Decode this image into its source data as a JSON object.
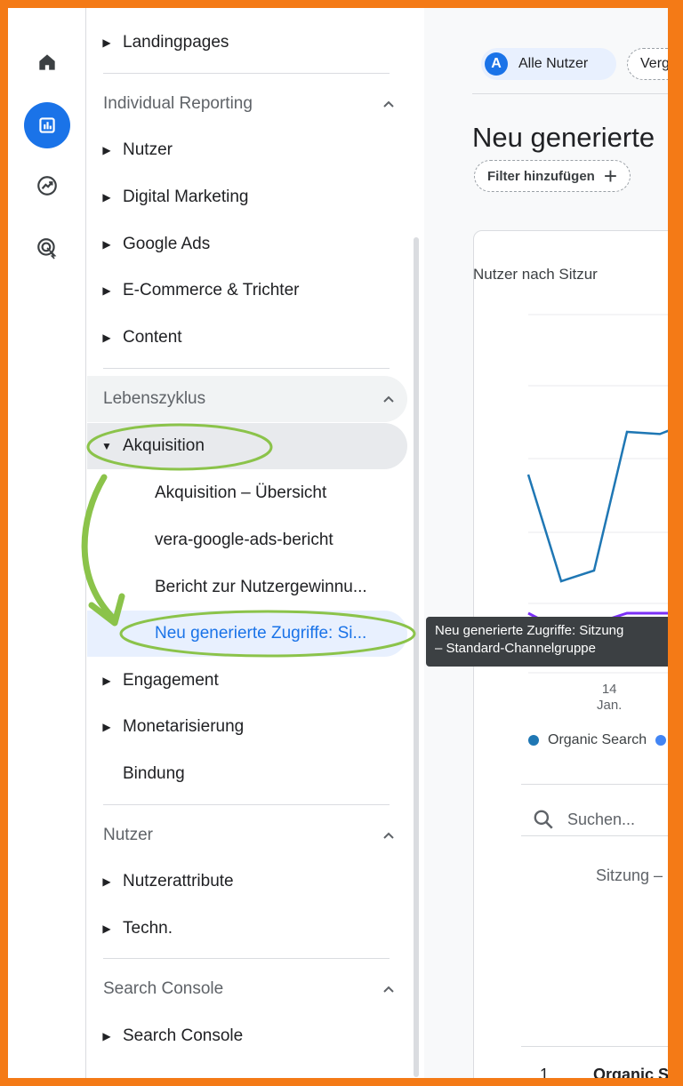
{
  "rail": {
    "icons": [
      "home-icon",
      "reports-icon",
      "explore-icon",
      "advertising-icon"
    ]
  },
  "nav": {
    "landingpages": "Landingpages",
    "individual_reporting": {
      "title": "Individual Reporting",
      "items": [
        "Nutzer",
        "Digital Marketing",
        "Google Ads",
        "E-Commerce & Trichter",
        "Content"
      ]
    },
    "lebenszyklus": {
      "title": "Lebenszyklus",
      "akquisition": "Akquisition",
      "akquisition_children": [
        "Akquisition – Übersicht",
        "vera-google-ads-bericht",
        "Bericht zur Nutzergewinnu...",
        "Neu generierte Zugriffe: Si..."
      ],
      "engagement": "Engagement",
      "monetarisierung": "Monetarisierung",
      "bindung": "Bindung"
    },
    "nutzer": {
      "title": "Nutzer",
      "items": [
        "Nutzerattribute",
        "Techn."
      ]
    },
    "search_console": {
      "title": "Search Console",
      "items": [
        "Search Console"
      ]
    }
  },
  "main": {
    "segment_avatar": "A",
    "segment_label": "Alle Nutzer",
    "compare_label": "Verg",
    "title": "Neu generierte",
    "filter_label": "Filter hinzufügen",
    "card_title": "Nutzer nach Sitzur",
    "x_tick_day": "14",
    "x_tick_month": "Jan.",
    "legend_label": "Organic Search",
    "search_placeholder": "Suchen...",
    "column_header": "Sitzung –",
    "row1_index": "1",
    "row1_label": "Organic S"
  },
  "tooltip": {
    "line1": "Neu generierte Zugriffe: Sitzung",
    "line2": "– Standard-Channelgruppe"
  },
  "colors": {
    "accent": "#1a73e8",
    "annotation": "#8bc34a",
    "border": "#f47a16",
    "series_organic": "#1f77b4",
    "series_purple": "#7b2ff7"
  },
  "chart_data": {
    "type": "line",
    "x": [
      "",
      "",
      "14 Jan.",
      "",
      "",
      ""
    ],
    "series": [
      {
        "name": "Organic Search",
        "values": [
          0.55,
          0.05,
          0.1,
          0.75,
          0.74,
          0.8
        ]
      },
      {
        "values": [
          -0.1,
          -0.18,
          -0.15,
          -0.1,
          -0.1,
          -0.1
        ]
      }
    ]
  }
}
